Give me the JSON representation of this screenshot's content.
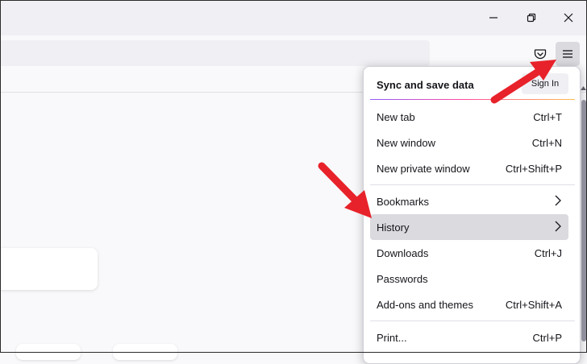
{
  "window": {
    "minimize_icon": "minimize-icon",
    "restore_icon": "restore-icon",
    "close_icon": "close-icon"
  },
  "toolbar": {
    "pocket_icon": "pocket-icon",
    "menu_icon": "hamburger-menu-icon"
  },
  "app_menu": {
    "sync_label": "Sync and save data",
    "sign_in_label": "Sign In",
    "items": [
      {
        "label": "New tab",
        "shortcut": "Ctrl+T"
      },
      {
        "label": "New window",
        "shortcut": "Ctrl+N"
      },
      {
        "label": "New private window",
        "shortcut": "Ctrl+Shift+P"
      },
      {
        "label": "Bookmarks",
        "submenu": true
      },
      {
        "label": "History",
        "submenu": true
      },
      {
        "label": "Downloads",
        "shortcut": "Ctrl+J"
      },
      {
        "label": "Passwords",
        "shortcut": ""
      },
      {
        "label": "Add-ons and themes",
        "shortcut": "Ctrl+Shift+A"
      },
      {
        "label": "Print...",
        "shortcut": "Ctrl+P"
      }
    ]
  },
  "colors": {
    "annotation_arrow": "#e8222a",
    "menu_hover": "#dadadf",
    "panel_bg": "#ffffff"
  }
}
